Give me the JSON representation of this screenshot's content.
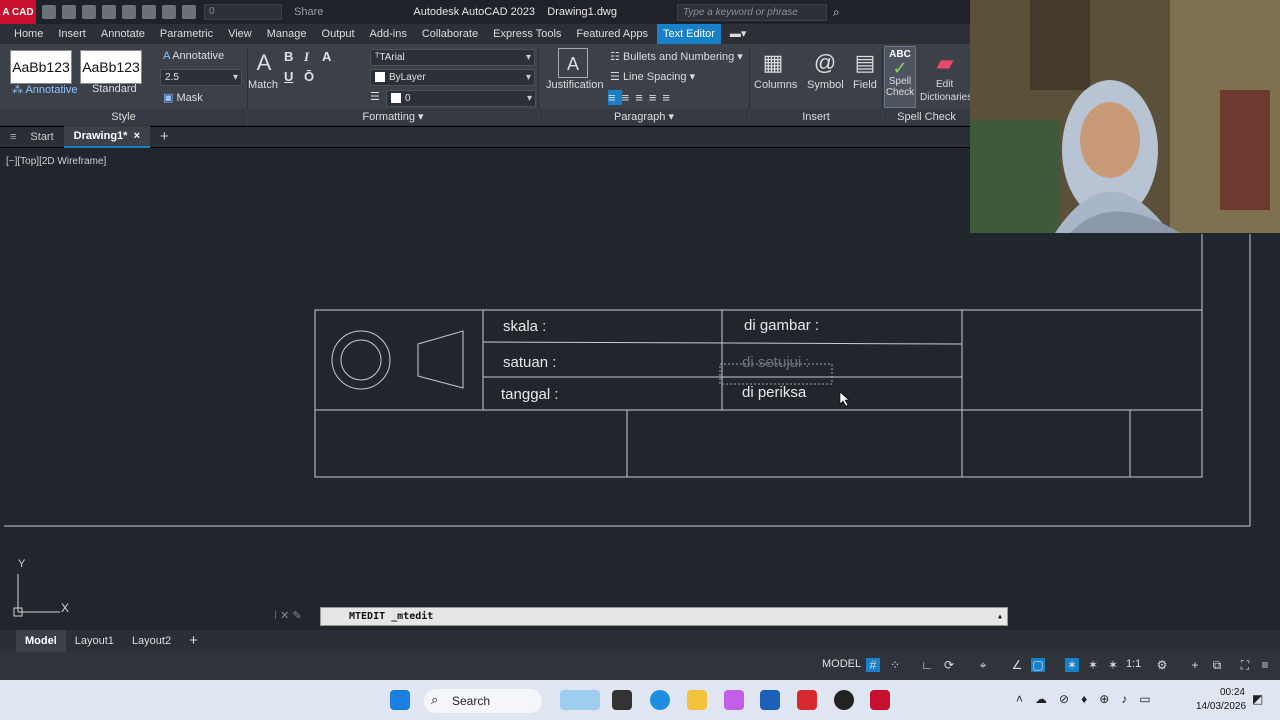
{
  "titlebar": {
    "app_logo": "A CAD",
    "quick_access_dropdown": "0",
    "share": "Share",
    "title": "Autodesk AutoCAD 2023",
    "document": "Drawing1.dwg",
    "search_placeholder": "Type a keyword or phrase"
  },
  "menu": {
    "tabs": [
      "Home",
      "Insert",
      "Annotate",
      "Parametric",
      "View",
      "Manage",
      "Output",
      "Add-ins",
      "Collaborate",
      "Express Tools",
      "Featured Apps",
      "Text Editor"
    ],
    "active": "Text Editor"
  },
  "ribbon": {
    "style": {
      "sample1_text": "AaBb123",
      "sample1_label": "Annotative",
      "sample2_text": "AaBb123",
      "sample2_label": "Standard",
      "annotative": "Annotative",
      "height_value": "2.5",
      "mask": "Mask",
      "panel_title": "Style"
    },
    "formatting": {
      "match": "Match",
      "bold": "B",
      "italic": "I",
      "underline": "U",
      "overline": "Ō",
      "font": "Arial",
      "color": "ByLayer",
      "layer_value": "0",
      "panel_title": "Formatting"
    },
    "paragraph": {
      "justification": "Justification",
      "bullets": "Bullets and Numbering",
      "line_spacing": "Line Spacing",
      "panel_title": "Paragraph"
    },
    "insert": {
      "columns": "Columns",
      "symbol": "Symbol",
      "field": "Field",
      "panel_title": "Insert"
    },
    "spellcheck": {
      "spell_icon": "ABC",
      "spell_line1": "Spell",
      "spell_line2": "Check",
      "edit_line1": "Edit",
      "edit_line2": "Dictionaries",
      "panel_title": "Spell Check"
    }
  },
  "file_tabs": {
    "start": "Start",
    "drawing": "Drawing1*",
    "close": "×",
    "add": "+"
  },
  "viewport": {
    "label": "[−][Top][2D Wireframe]"
  },
  "drawing_text": {
    "skala": "skala   :",
    "satuan": "satuan  :",
    "tanggal": "tanggal  :",
    "di_gambar": "di gambar :",
    "di_setujui": "di setujui :",
    "di_periksa": "di periksa"
  },
  "ucs": {
    "y": "Y",
    "x": "X"
  },
  "command": {
    "text": "MTEDIT _mtedit"
  },
  "layout_tabs": {
    "tabs": [
      "Model",
      "Layout1",
      "Layout2"
    ],
    "add": "+"
  },
  "statusbar": {
    "model": "MODEL",
    "scale": "1:1"
  },
  "taskbar": {
    "search": "Search",
    "time": "00:24",
    "date": "14/03/2026"
  },
  "colors": {
    "accent": "#1780c8",
    "canvas": "#21262d",
    "ribbon": "#3b4049",
    "autocad_red": "#c8102e"
  }
}
